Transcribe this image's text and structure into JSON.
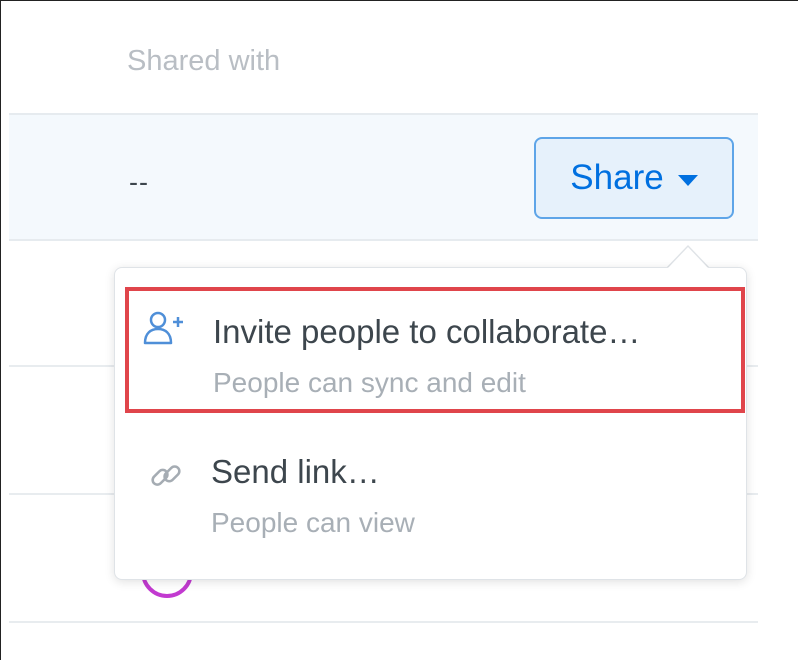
{
  "table": {
    "column_header": "Shared with",
    "selected_row": {
      "shared_with_value": "--",
      "share_button_label": "Share"
    }
  },
  "share_menu": {
    "items": [
      {
        "icon": "add-person-icon",
        "title": "Invite people to collaborate…",
        "subtitle": "People can sync and edit"
      },
      {
        "icon": "link-icon",
        "title": "Send link…",
        "subtitle": "People can view"
      }
    ]
  },
  "colors": {
    "accent": "#0070e0",
    "highlight_border": "#e0454b",
    "avatar_ring": "#c23ad0"
  }
}
